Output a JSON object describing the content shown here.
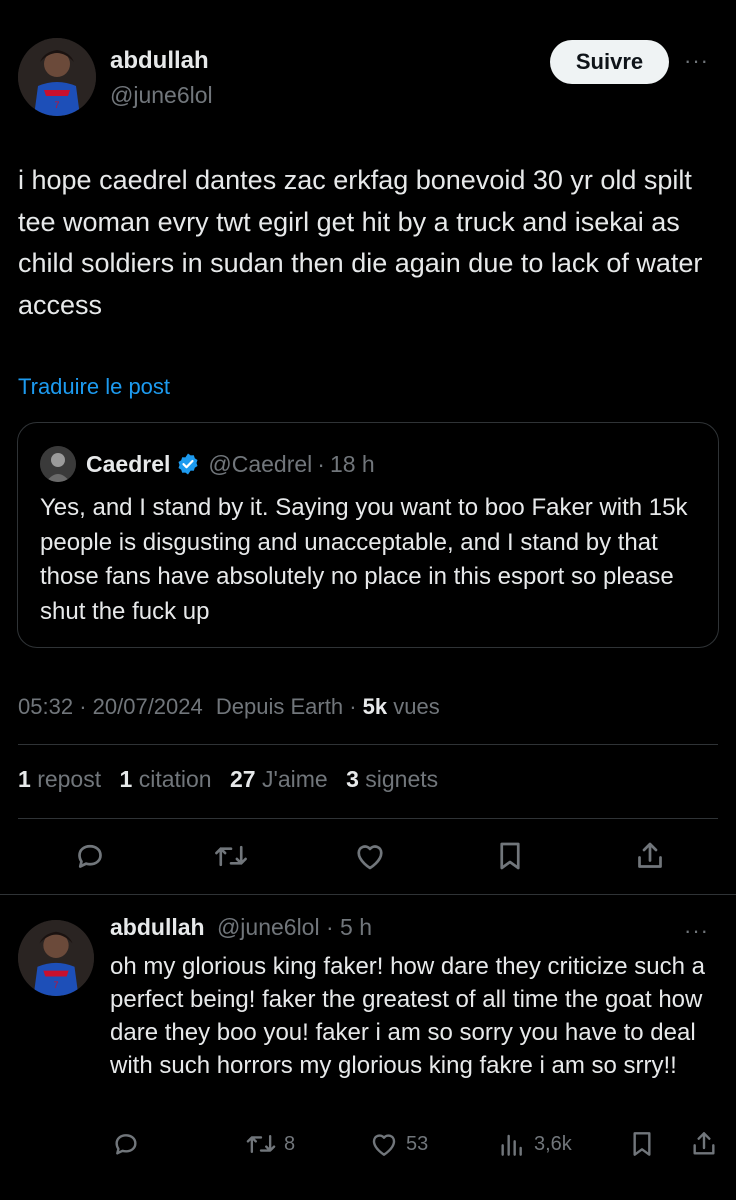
{
  "post": {
    "author_name": "abdullah",
    "author_handle": "@june6lol",
    "follow_label": "Suivre",
    "more_label": "···",
    "text": "i hope caedrel dantes zac erkfag bonevoid 30 yr old spilt tee woman evry twt egirl get hit by a truck and isekai as child soldiers in sudan then die again due to lack of water access",
    "translate_label": "Traduire le post",
    "time": "05:32",
    "date": "20/07/2024",
    "location": "Depuis Earth",
    "views_count": "5k",
    "views_label": "vues",
    "stats": {
      "reposts_count": "1",
      "reposts_label": "repost",
      "quotes_count": "1",
      "quotes_label": "citation",
      "likes_count": "27",
      "likes_label": "J'aime",
      "bookmarks_count": "3",
      "bookmarks_label": "signets"
    }
  },
  "quoted": {
    "author_name": "Caedrel",
    "author_handle": "@Caedrel",
    "time": "18 h",
    "text": "Yes, and I stand by it. Saying you want to boo Faker with 15k people is disgusting and unacceptable, and I stand by that those fans have absolutely no place in this esport so please shut the fuck up"
  },
  "reply": {
    "author_name": "abdullah",
    "author_handle": "@june6lol",
    "time": "5 h",
    "more_label": "···",
    "text": "oh my glorious king faker! how dare they criticize such a perfect being! faker the greatest of all time the goat how dare they boo you! faker i am so sorry you have to deal with such horrors my glorious king fakre i am so srry!!",
    "reposts": "8",
    "likes": "53",
    "views": "3,6k"
  },
  "colors": {
    "background": "#000000",
    "text": "#e7e9ea",
    "muted": "#71767b",
    "accent": "#1d9bf0",
    "border": "#2f3336"
  }
}
